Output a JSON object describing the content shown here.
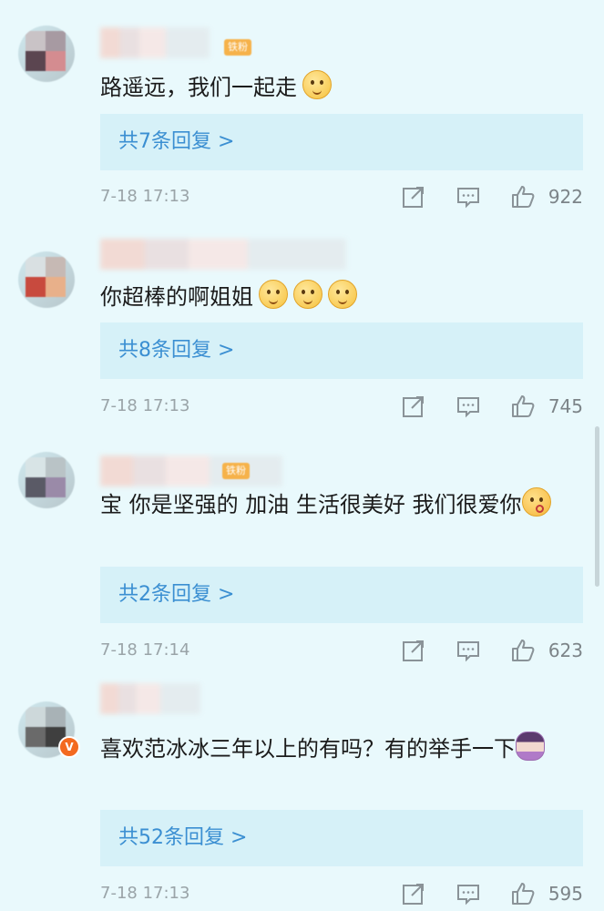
{
  "comments": [
    {
      "badge": "铁粉",
      "text": "路遥远，我们一起走",
      "emojis": [
        "smiley"
      ],
      "replies": "共7条回复 >",
      "time": "7-18 17:13",
      "likes": "922"
    },
    {
      "text": "你超棒的啊姐姐",
      "emojis": [
        "pleading",
        "pleading",
        "pleading"
      ],
      "replies": "共8条回复 >",
      "time": "7-18 17:13",
      "likes": "745"
    },
    {
      "badge": "铁粉",
      "text": "宝 你是坚强的 加油 生活很美好 我们很爱你",
      "emojis": [
        "kiss"
      ],
      "replies": "共2条回复 >",
      "time": "7-18 17:14",
      "likes": "623"
    },
    {
      "verified": true,
      "text": "喜欢范冰冰三年以上的有吗？有的举手一下",
      "emojis": [
        "raising-hand"
      ],
      "replies": "共52条回复 >",
      "time": "7-18 17:13",
      "likes": "595"
    }
  ],
  "colors": {
    "background": "#e9f9fc",
    "reply_box": "#d6f1f8",
    "link": "#3b8fd2",
    "meta": "#9aa4a8",
    "badge": "#f6b24a",
    "verified": "#f36a20"
  },
  "icons": [
    "share-icon",
    "comment-icon",
    "like-icon"
  ]
}
